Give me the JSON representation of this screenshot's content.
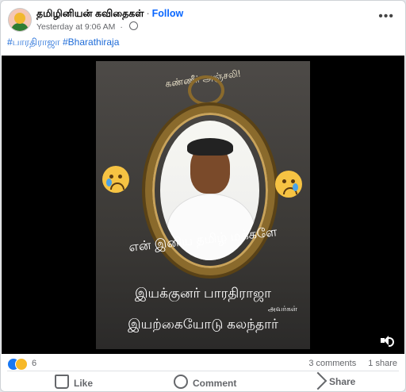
{
  "post": {
    "author": "தமிழினியன் கவிதைகள்",
    "follow_label": "Follow",
    "separator": "·",
    "timestamp": "Yesterday at 9:06 AM",
    "audience_icon": "globe-icon",
    "more_icon": "more-options-icon",
    "more_label": "•••",
    "hashtags": [
      "#பாரதிராஜா",
      "#Bharathiraja"
    ]
  },
  "poster": {
    "header_text": "கண்ணீர் அஞ்சலி!",
    "poem_line": "என் இனிய தமிழ் மக்களே",
    "name_line": "இயக்குனர் பாரதிராஜா",
    "honorific": "அவர்கள்",
    "final_line": "இயற்கையோடு கலந்தார்",
    "emoji_icon": "crying-face-icon"
  },
  "stats": {
    "reaction_count": "6",
    "comments": "3 comments",
    "shares": "1 share"
  },
  "actions": {
    "like": "Like",
    "comment": "Comment",
    "share": "Share"
  },
  "colors": {
    "link": "#1d6bd8",
    "follow": "#0866ff",
    "like_reaction": "#1877f2",
    "sad_reaction": "#f7b928"
  }
}
